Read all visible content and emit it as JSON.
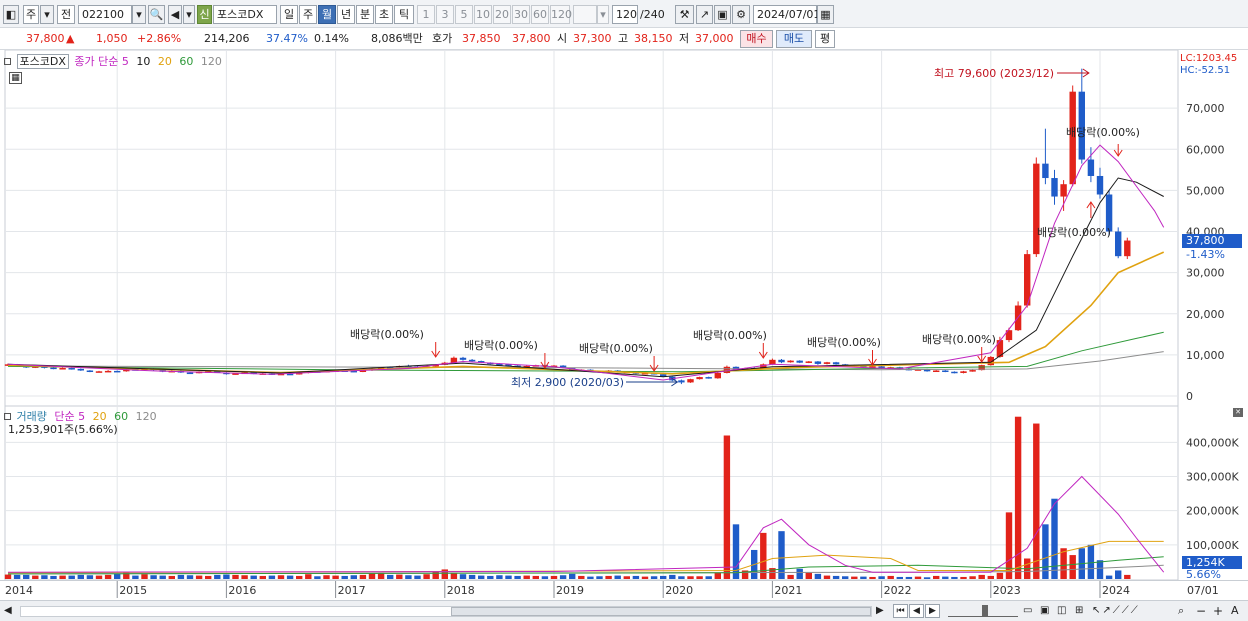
{
  "toolbar": {
    "item_type": "주",
    "mode": "전",
    "code": "022100",
    "new_badge": "신",
    "stock_name": "포스코DX",
    "periods": [
      "일",
      "주",
      "월",
      "년",
      "분",
      "초",
      "틱"
    ],
    "active_period": "월",
    "minute_options": [
      "1",
      "3",
      "5",
      "10",
      "20",
      "30",
      "60",
      "120"
    ],
    "count": "120",
    "count_total": "/240",
    "date": "2024/07/01"
  },
  "quote": {
    "price": "37,800",
    "direction": "▲",
    "change": "1,050",
    "change_pct": "+2.86%",
    "volume": "214,206",
    "volume_ratio": "37.47%",
    "turnover": "0.14%",
    "amount": "8,086백만",
    "hoga_label": "호가",
    "ask": "37,850",
    "bid": "37,800",
    "open_label": "시",
    "open": "37,300",
    "high_label": "고",
    "high": "38,150",
    "low_label": "저",
    "low": "37,000",
    "buy": "매수",
    "sell": "매도",
    "avg": "평"
  },
  "price_pane": {
    "name_tag": "포스코DX",
    "series_label": "종가 단순",
    "periods": [
      "5",
      "10",
      "20",
      "60",
      "120"
    ],
    "lc": "LC:1203.45",
    "hc": "HC:-52.51",
    "current_tag": "37,800",
    "current_pct": "-1.43%",
    "high_note": "최고 79,600 (2023/12)",
    "low_note": "최저 2,900 (2020/03)",
    "dividend_label": "배당락(0.00%)"
  },
  "volume_pane": {
    "title": "거래량",
    "ma_label": "단순",
    "periods": [
      "5",
      "20",
      "60",
      "120"
    ],
    "current": "1,253,901주(5.66%)",
    "current_tag": "1,254K",
    "current_pct": "5.66%"
  },
  "colors": {
    "up": "#e2231a",
    "down": "#1f5cc9",
    "ma5": "#c026c0",
    "ma10": "#1a1a1a",
    "ma20": "#e0a210",
    "ma60": "#2f9a3a",
    "ma120": "#8c8c8c"
  },
  "chart_data": {
    "type": "candlestick",
    "time_axis": [
      "2014",
      "2015",
      "2016",
      "2017",
      "2018",
      "2019",
      "2020",
      "2021",
      "2022",
      "2023",
      "2024",
      "07/01"
    ],
    "price_axis": [
      "70,000",
      "60,000",
      "50,000",
      "40,000",
      "30,000",
      "20,000",
      "10,000",
      "0"
    ],
    "volume_axis": [
      "400,000K",
      "300,000K",
      "200,000K",
      "100,000K"
    ],
    "ylim_price": [
      0,
      80000
    ],
    "ylim_volume": [
      0,
      480000
    ],
    "start_month": "2014/01",
    "candles": [
      [
        7600,
        7900,
        7300,
        7700
      ],
      [
        7700,
        7800,
        7100,
        7300
      ],
      [
        7300,
        7400,
        6800,
        7000
      ],
      [
        7000,
        7300,
        6800,
        7200
      ],
      [
        7200,
        7300,
        6700,
        6900
      ],
      [
        6900,
        7000,
        6500,
        6700
      ],
      [
        6700,
        6900,
        6500,
        6800
      ],
      [
        6800,
        6900,
        6400,
        6600
      ],
      [
        6600,
        6700,
        6100,
        6200
      ],
      [
        6200,
        6300,
        5800,
        5900
      ],
      [
        5900,
        6100,
        5800,
        6000
      ],
      [
        6000,
        6300,
        5900,
        6100
      ],
      [
        6100,
        6200,
        5800,
        6000
      ],
      [
        6000,
        6600,
        5900,
        6500
      ],
      [
        6500,
        6700,
        6200,
        6300
      ],
      [
        6300,
        6800,
        6200,
        6700
      ],
      [
        6700,
        6800,
        6200,
        6300
      ],
      [
        6300,
        6400,
        5800,
        5900
      ],
      [
        5900,
        6200,
        5800,
        6100
      ],
      [
        6100,
        6200,
        5600,
        5700
      ],
      [
        5700,
        5900,
        5500,
        5600
      ],
      [
        5600,
        6000,
        5500,
        5900
      ],
      [
        5900,
        6200,
        5800,
        6000
      ],
      [
        6000,
        6100,
        5600,
        5700
      ],
      [
        5700,
        5800,
        5200,
        5300
      ],
      [
        5300,
        5600,
        5200,
        5500
      ],
      [
        5500,
        5800,
        5400,
        5700
      ],
      [
        5700,
        5800,
        5300,
        5400
      ],
      [
        5400,
        5600,
        5300,
        5500
      ],
      [
        5500,
        5600,
        5100,
        5200
      ],
      [
        5200,
        5500,
        5100,
        5400
      ],
      [
        5400,
        5500,
        5200,
        5300
      ],
      [
        5300,
        5700,
        5200,
        5600
      ],
      [
        5600,
        6100,
        5500,
        6000
      ],
      [
        6000,
        6100,
        5700,
        5800
      ],
      [
        5800,
        6200,
        5700,
        6100
      ],
      [
        6100,
        6300,
        5900,
        6200
      ],
      [
        6200,
        6400,
        6000,
        6100
      ],
      [
        6100,
        6200,
        5800,
        5900
      ],
      [
        5900,
        6300,
        5800,
        6200
      ],
      [
        6200,
        6700,
        6100,
        6600
      ],
      [
        6600,
        7100,
        6500,
        7000
      ],
      [
        7000,
        7200,
        6800,
        6900
      ],
      [
        6900,
        7400,
        6800,
        7300
      ],
      [
        7300,
        7600,
        7100,
        7200
      ],
      [
        7200,
        7300,
        6900,
        7000
      ],
      [
        7000,
        7300,
        6900,
        7200
      ],
      [
        7200,
        7700,
        7100,
        7600
      ],
      [
        7600,
        8300,
        7500,
        8100
      ],
      [
        8100,
        9600,
        8000,
        9300
      ],
      [
        9300,
        9500,
        8600,
        8800
      ],
      [
        8800,
        9000,
        8300,
        8500
      ],
      [
        8500,
        8600,
        8000,
        8100
      ],
      [
        8100,
        8200,
        7700,
        7800
      ],
      [
        7800,
        8000,
        7500,
        7700
      ],
      [
        7700,
        7800,
        7300,
        7400
      ],
      [
        7400,
        7500,
        7000,
        7100
      ],
      [
        7100,
        7400,
        7000,
        7300
      ],
      [
        7300,
        7600,
        7200,
        7500
      ],
      [
        7500,
        7600,
        7100,
        7200
      ],
      [
        7200,
        7500,
        7100,
        7400
      ],
      [
        7400,
        7500,
        6700,
        6800
      ],
      [
        6800,
        6900,
        6000,
        6100
      ],
      [
        6100,
        6500,
        6000,
        6400
      ],
      [
        6400,
        6500,
        6000,
        6100
      ],
      [
        6100,
        6200,
        5800,
        5900
      ],
      [
        5900,
        6300,
        5800,
        6200
      ],
      [
        6200,
        6300,
        5700,
        5800
      ],
      [
        5800,
        6000,
        5700,
        5900
      ],
      [
        5900,
        6000,
        5300,
        5400
      ],
      [
        5400,
        5700,
        5300,
        5600
      ],
      [
        5600,
        5700,
        5200,
        5300
      ],
      [
        5300,
        5400,
        4600,
        4700
      ],
      [
        4700,
        4800,
        3600,
        3800
      ],
      [
        3800,
        4000,
        2900,
        3300
      ],
      [
        3300,
        4200,
        3200,
        4100
      ],
      [
        4100,
        4700,
        4000,
        4600
      ],
      [
        4600,
        4700,
        4200,
        4300
      ],
      [
        4300,
        5800,
        4200,
        5600
      ],
      [
        5600,
        7400,
        5500,
        7100
      ],
      [
        7100,
        7200,
        6100,
        6300
      ],
      [
        6300,
        6900,
        6200,
        6800
      ],
      [
        6800,
        7100,
        6400,
        6600
      ],
      [
        6600,
        7900,
        6500,
        7700
      ],
      [
        7700,
        9100,
        7600,
        8800
      ],
      [
        8800,
        9000,
        8000,
        8200
      ],
      [
        8200,
        8700,
        8100,
        8600
      ],
      [
        8600,
        8700,
        8000,
        8100
      ],
      [
        8100,
        8500,
        8000,
        8400
      ],
      [
        8400,
        8500,
        7600,
        7800
      ],
      [
        7800,
        8300,
        7700,
        8200
      ],
      [
        8200,
        8300,
        7600,
        7700
      ],
      [
        7700,
        7800,
        7200,
        7300
      ],
      [
        7300,
        7600,
        7100,
        7500
      ],
      [
        7500,
        7600,
        6900,
        7000
      ],
      [
        7000,
        7300,
        6800,
        7200
      ],
      [
        7200,
        7300,
        6600,
        6700
      ],
      [
        6700,
        7100,
        6600,
        7000
      ],
      [
        7000,
        7100,
        6500,
        6600
      ],
      [
        6600,
        6700,
        6200,
        6300
      ],
      [
        6300,
        6600,
        6200,
        6500
      ],
      [
        6500,
        6600,
        5900,
        6000
      ],
      [
        6000,
        6300,
        5900,
        6200
      ],
      [
        6200,
        6300,
        5800,
        5900
      ],
      [
        5900,
        6000,
        5500,
        5600
      ],
      [
        5600,
        6100,
        5500,
        6000
      ],
      [
        6000,
        6400,
        5900,
        6300
      ],
      [
        6300,
        7600,
        6200,
        7500
      ],
      [
        7500,
        9700,
        7400,
        9500
      ],
      [
        9500,
        14400,
        9300,
        13600
      ],
      [
        13600,
        16600,
        13100,
        16000
      ],
      [
        16000,
        23000,
        15800,
        22000
      ],
      [
        22000,
        35500,
        21500,
        34500
      ],
      [
        34500,
        58000,
        33800,
        56500
      ],
      [
        56500,
        65000,
        51500,
        53000
      ],
      [
        53000,
        55000,
        46500,
        48500
      ],
      [
        48500,
        52500,
        45000,
        51500
      ],
      [
        51500,
        75500,
        51000,
        74000
      ],
      [
        74000,
        79600,
        56500,
        57500
      ],
      [
        57500,
        60500,
        52000,
        53500
      ],
      [
        53500,
        55500,
        48000,
        49000
      ],
      [
        49000,
        50000,
        39000,
        40000
      ],
      [
        40000,
        41000,
        33500,
        34000
      ],
      [
        34000,
        38500,
        33300,
        37800
      ]
    ],
    "ma": {
      "ma5": [
        [
          0,
          7700
        ],
        [
          16,
          6100
        ],
        [
          29,
          5300
        ],
        [
          44,
          6700
        ],
        [
          50,
          8400
        ],
        [
          60,
          7100
        ],
        [
          72,
          3900
        ],
        [
          84,
          7700
        ],
        [
          98,
          6600
        ],
        [
          108,
          10500
        ],
        [
          112,
          22000
        ],
        [
          115,
          42000
        ],
        [
          118,
          56000
        ],
        [
          120,
          61000
        ],
        [
          122,
          57000
        ],
        [
          126,
          45000
        ],
        [
          127,
          41000
        ]
      ],
      "ma10": [
        [
          0,
          7700
        ],
        [
          30,
          5600
        ],
        [
          50,
          8000
        ],
        [
          72,
          4700
        ],
        [
          84,
          7100
        ],
        [
          108,
          8200
        ],
        [
          113,
          16000
        ],
        [
          117,
          34000
        ],
        [
          120,
          47000
        ],
        [
          122,
          53000
        ],
        [
          124,
          52000
        ],
        [
          127,
          48500
        ]
      ],
      "ma20": [
        [
          0,
          7500
        ],
        [
          30,
          5700
        ],
        [
          50,
          7200
        ],
        [
          73,
          5400
        ],
        [
          86,
          6900
        ],
        [
          110,
          8200
        ],
        [
          114,
          12000
        ],
        [
          119,
          22000
        ],
        [
          122,
          30000
        ],
        [
          127,
          35000
        ]
      ],
      "ma60": [
        [
          0,
          7200
        ],
        [
          40,
          6300
        ],
        [
          74,
          5900
        ],
        [
          96,
          6700
        ],
        [
          112,
          7200
        ],
        [
          118,
          11000
        ],
        [
          124,
          14000
        ],
        [
          127,
          15500
        ]
      ],
      "ma120": [
        [
          0,
          7300
        ],
        [
          60,
          6900
        ],
        [
          96,
          6400
        ],
        [
          112,
          6600
        ],
        [
          120,
          8500
        ],
        [
          127,
          10800
        ]
      ]
    },
    "volume_ma": {
      "ma5": [
        [
          0,
          20000
        ],
        [
          60,
          22000
        ],
        [
          80,
          35000
        ],
        [
          83,
          150000
        ],
        [
          85,
          175000
        ],
        [
          88,
          100000
        ],
        [
          92,
          40000
        ],
        [
          95,
          20000
        ],
        [
          108,
          20000
        ],
        [
          112,
          90000
        ],
        [
          115,
          220000
        ],
        [
          118,
          300000
        ],
        [
          122,
          190000
        ],
        [
          124,
          120000
        ],
        [
          127,
          20000
        ]
      ],
      "ma20": [
        [
          0,
          18000
        ],
        [
          80,
          25000
        ],
        [
          84,
          60000
        ],
        [
          90,
          70000
        ],
        [
          97,
          60000
        ],
        [
          100,
          25000
        ],
        [
          110,
          25000
        ],
        [
          116,
          80000
        ],
        [
          121,
          110000
        ],
        [
          127,
          110000
        ]
      ],
      "ma60": [
        [
          0,
          15000
        ],
        [
          80,
          18000
        ],
        [
          88,
          35000
        ],
        [
          100,
          40000
        ],
        [
          112,
          30000
        ],
        [
          122,
          55000
        ],
        [
          127,
          65000
        ]
      ],
      "ma120": [
        [
          0,
          15000
        ],
        [
          100,
          20000
        ],
        [
          112,
          22000
        ],
        [
          127,
          40000
        ]
      ]
    },
    "volumes": [
      13000,
      12000,
      12000,
      10000,
      11000,
      9000,
      10000,
      10000,
      12000,
      11000,
      10000,
      12000,
      15000,
      20000,
      10000,
      14000,
      11000,
      10000,
      9000,
      12000,
      11000,
      10000,
      9000,
      12000,
      13000,
      12000,
      11000,
      10000,
      9000,
      10000,
      11000,
      10000,
      9000,
      14000,
      8000,
      11000,
      10000,
      9000,
      11000,
      12000,
      16000,
      18000,
      12000,
      13000,
      11000,
      10000,
      14000,
      22000,
      28000,
      18000,
      14000,
      12000,
      10000,
      9000,
      11000,
      10000,
      9000,
      10000,
      9000,
      8000,
      9000,
      11000,
      15000,
      9000,
      7000,
      8000,
      9000,
      10000,
      8000,
      9000,
      7000,
      8000,
      9000,
      12000,
      8000,
      8000,
      8000,
      8000,
      18000,
      420000,
      160000,
      25000,
      85000,
      135000,
      32000,
      140000,
      12000,
      30000,
      18000,
      15000,
      10000,
      9000,
      8000,
      7000,
      7000,
      6000,
      8000,
      9000,
      6000,
      6000,
      7000,
      5000,
      9000,
      7000,
      6000,
      6000,
      8000,
      12000,
      9000,
      18000,
      195000,
      475000,
      60000,
      455000,
      160000,
      235000,
      90000,
      70000,
      90000,
      100000,
      55000,
      10000,
      25000,
      12000
    ]
  }
}
